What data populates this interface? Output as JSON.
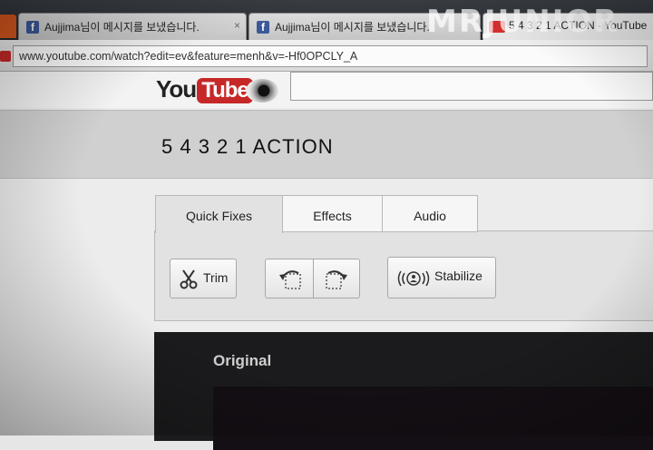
{
  "browser": {
    "tabs": [
      {
        "label": "Aujjima님이 메시지를 보냈습니다.",
        "icon": "facebook-icon",
        "close": "×"
      },
      {
        "label": "Aujjima님이 메시지를 보냈습니다.",
        "icon": "facebook-icon",
        "close": ""
      },
      {
        "label": "5 4 3 2 1 ACTION - YouTube",
        "icon": "youtube-icon",
        "close": ""
      }
    ],
    "url": "www.youtube.com/watch?edit=ev&feature=menh&v=-Hf0OPCLY_A"
  },
  "watermark": "MRJUNIOR",
  "logo": {
    "you": "You",
    "tube": "Tube"
  },
  "video": {
    "title": "5 4 3 2 1 ACTION"
  },
  "editor": {
    "tabs": [
      "Quick Fixes",
      "Effects",
      "Audio"
    ],
    "active_tab": "Quick Fixes",
    "buttons": {
      "trim": "Trim",
      "stabilize": "Stabilize"
    }
  },
  "preview": {
    "label": "Original"
  },
  "colors": {
    "youtube_red": "#c62828",
    "facebook_blue": "#3b5998",
    "video_bg": "#1b1b1d"
  }
}
